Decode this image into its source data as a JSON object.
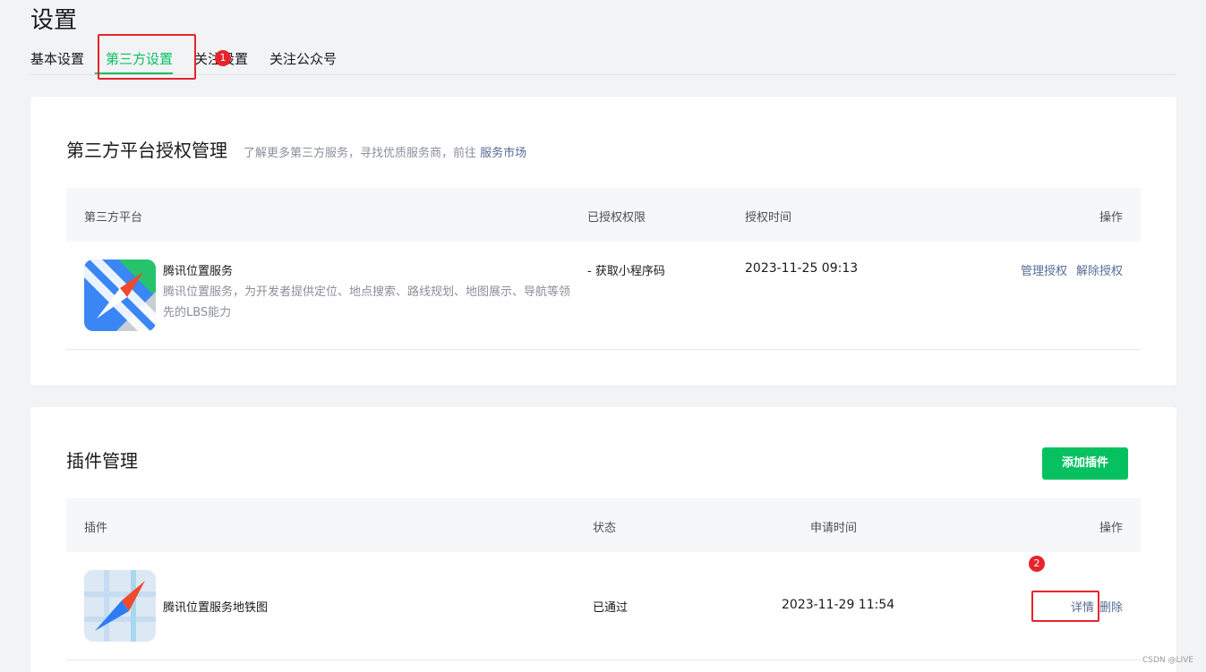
{
  "page": {
    "title": "设置"
  },
  "tabs": [
    {
      "label": "基本设置"
    },
    {
      "label": "第三方设置"
    },
    {
      "label": "关注设置"
    },
    {
      "label": "关注公众号"
    }
  ],
  "annotations": {
    "badge1": "1",
    "badge2": "2"
  },
  "auth_card": {
    "title": "第三方平台授权管理",
    "desc_prefix": "了解更多第三方服务，寻找优质服务商，前往",
    "desc_link": "服务市场",
    "columns": {
      "platform": "第三方平台",
      "permission": "已授权权限",
      "time": "授权时间",
      "action": "操作"
    },
    "rows": [
      {
        "icon": "tencent-location-service-icon",
        "name": "腾讯位置服务",
        "desc": "腾讯位置服务，为开发者提供定位、地点搜索、路线规划、地图展示、导航等领先的LBS能力",
        "permission": "- 获取小程序码",
        "time": "2023-11-25 09:13",
        "actions": [
          "管理授权",
          "解除授权"
        ]
      }
    ]
  },
  "plugin_card": {
    "title": "插件管理",
    "add_button": "添加插件",
    "columns": {
      "plugin": "插件",
      "status": "状态",
      "apply_time": "申请时间",
      "action": "操作"
    },
    "rows": [
      {
        "icon": "tencent-map-subway-plugin-icon",
        "name": "腾讯位置服务地铁图",
        "status": "已通过",
        "time": "2023-11-29 11:54",
        "actions": [
          "详情",
          "删除"
        ]
      }
    ]
  },
  "watermark": "CSDN @LIVE",
  "colors": {
    "accent": "#07c160",
    "link": "#576b95",
    "annotation": "#e6242b"
  }
}
